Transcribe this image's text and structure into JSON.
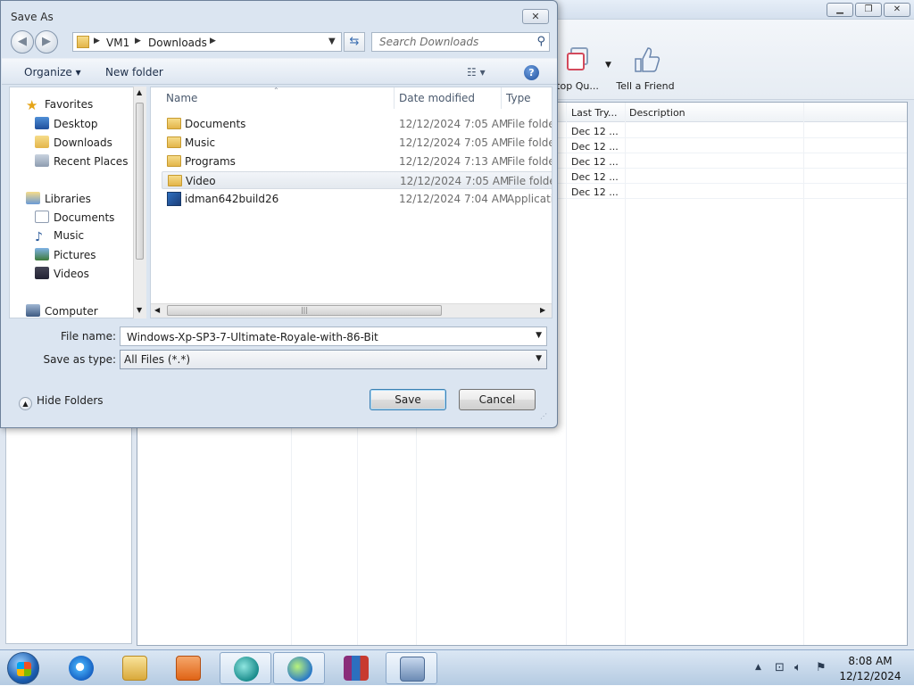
{
  "dialog": {
    "title": "Save As",
    "close_glyph": "✕",
    "breadcrumb": [
      "VM1",
      "Downloads"
    ],
    "search_placeholder": "Search Downloads",
    "command_bar": {
      "organize": "Organize ▾",
      "new_folder": "New folder",
      "view_glyph": "☷ ▾",
      "help": "?"
    },
    "nav_pane": [
      {
        "label": "Favorites",
        "icon": "star-icon",
        "group": true
      },
      {
        "label": "Desktop",
        "icon": "desktop-icon"
      },
      {
        "label": "Downloads",
        "icon": "downloads-icon"
      },
      {
        "label": "Recent Places",
        "icon": "recent-places-icon"
      },
      {
        "label": "Libraries",
        "icon": "libraries-icon",
        "group": true
      },
      {
        "label": "Documents",
        "icon": "documents-icon"
      },
      {
        "label": "Music",
        "icon": "music-icon"
      },
      {
        "label": "Pictures",
        "icon": "pictures-icon"
      },
      {
        "label": "Videos",
        "icon": "videos-icon"
      },
      {
        "label": "Computer",
        "icon": "computer-icon",
        "group": true
      }
    ],
    "columns": {
      "name": "Name",
      "date": "Date modified",
      "type": "Type"
    },
    "files": [
      {
        "name": "Documents",
        "date": "12/12/2024 7:05 AM",
        "type": "File folder",
        "kind": "folder"
      },
      {
        "name": "Music",
        "date": "12/12/2024 7:05 AM",
        "type": "File folder",
        "kind": "folder"
      },
      {
        "name": "Programs",
        "date": "12/12/2024 7:13 AM",
        "type": "File folder",
        "kind": "folder"
      },
      {
        "name": "Video",
        "date": "12/12/2024 7:05 AM",
        "type": "File folder",
        "kind": "folder",
        "selected": true
      },
      {
        "name": "idman642build26",
        "date": "12/12/2024 7:04 AM",
        "type": "Application",
        "kind": "app"
      }
    ],
    "file_name_label": "File name:",
    "file_name_value": "Windows-Xp-SP3-7-Ultimate-Royale-with-86-Bit",
    "save_type_label": "Save as type:",
    "save_type_value": "All Files (*.*)",
    "hide_folders": "Hide Folders",
    "save": "Save",
    "cancel": "Cancel"
  },
  "background_app": {
    "toolbar": {
      "stop_queue": "top Qu...",
      "tell_friend": "Tell a Friend"
    },
    "columns": {
      "last_try": "Last Try...",
      "description": "Description"
    },
    "last_try_values": [
      "Dec 12 ...",
      "Dec 12 ...",
      "Dec 12 ...",
      "Dec 12 ...",
      "Dec 12 ..."
    ]
  },
  "taskbar": {
    "apps": [
      "internet-explorer-icon",
      "windows-explorer-icon",
      "media-player-icon",
      "app-globe-icon",
      "idm-icon",
      "winrar-icon",
      "network-computer-icon"
    ],
    "time": "8:08 AM",
    "date": "12/12/2024"
  },
  "colors": {
    "accent": "#3c7fb1",
    "dialog_bg": "#dbe5f1",
    "taskbar": "#b5cbe2"
  }
}
